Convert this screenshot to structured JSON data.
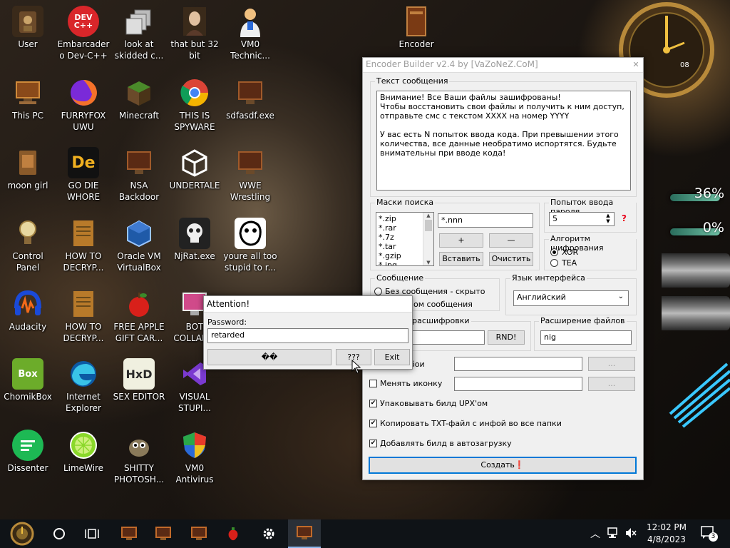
{
  "desktop": {
    "icons": [
      {
        "label": "User"
      },
      {
        "label": "Embarcadero Dev-C++"
      },
      {
        "label": "look at skidded c..."
      },
      {
        "label": "that but 32 bit"
      },
      {
        "label": "VM0 Technic..."
      },
      {
        "label": "Encoder"
      },
      {
        "label": "This PC"
      },
      {
        "label": "FURRYFOX UWU"
      },
      {
        "label": "Minecraft"
      },
      {
        "label": "THIS IS SPYWARE"
      },
      {
        "label": "sdfasdf.exe"
      },
      {
        "label": "moon girl"
      },
      {
        "label": "GO DIE WHORE"
      },
      {
        "label": "NSA Backdoor"
      },
      {
        "label": "UNDERTALE"
      },
      {
        "label": "WWE Wrestling"
      },
      {
        "label": "Control Panel"
      },
      {
        "label": "HOW TO DECRYP..."
      },
      {
        "label": "Oracle VM VirtualBox"
      },
      {
        "label": "NjRat.exe"
      },
      {
        "label": "youre all too stupid to r..."
      },
      {
        "label": "Audacity"
      },
      {
        "label": "HOW TO DECRYP..."
      },
      {
        "label": "FREE APPLE GIFT CAR..."
      },
      {
        "label": "BOT COLLAB..."
      },
      {
        "label": "ChomikBox"
      },
      {
        "label": "Internet Explorer"
      },
      {
        "label": "SEX EDITOR"
      },
      {
        "label": "VISUAL STUPI..."
      },
      {
        "label": "Dissenter"
      },
      {
        "label": "LimeWire"
      },
      {
        "label": "SHITTY PHOTOSH..."
      },
      {
        "label": "VM0 Antivirus"
      }
    ],
    "icon_glyphs": {
      "dev": "DEV C++",
      "de": "De",
      "box": "Box",
      "hxd": "HxD"
    }
  },
  "gauges": [
    {
      "label": "36%"
    },
    {
      "label": "0%"
    }
  ],
  "clock": {
    "label": "08"
  },
  "encoder": {
    "title": "Encoder Builder v2.4 by [VaZoNeZ.CoM]",
    "close": "✕",
    "message_group": "Текст сообщения",
    "message_text": "Внимание! Все Ваши файлы зашифрованы!\nЧтобы восстановить свои файлы и получить к ним доступ,\nотправьте смс с текстом XXXX на номер YYYY\n\nУ вас есть N попыток ввода кода. При превышении этого\nколичества, все данные необратимо испортятся. Будьте\nвнимательны при вводе кода!",
    "masks_group": "Маски поиска",
    "masks": [
      "*.zip",
      "*.rar",
      "*.7z",
      "*.tar",
      "*.gzip",
      "*.jpg"
    ],
    "mask_input": "*.nnn",
    "btn_plus": "+",
    "btn_minus": "—",
    "btn_paste": "Вставить",
    "btn_clear": "Очистить",
    "attempts_group": "Попыток ввода пароля",
    "attempts_value": "5",
    "attempts_help": "?",
    "algo_group": "Алгоритм шифрования",
    "algo_xor": "XOR",
    "algo_tea": "TEA",
    "message_opt_group": "Сообщение",
    "msg_opt_hidden": "Без сообщения - скрыто",
    "msg_opt_with": "ом сообщения",
    "lang_group": "Язык интерфейса",
    "lang_value": "Английский",
    "decrypt_group": "я расшифровки",
    "btn_rnd": "RND!",
    "ext_group": "Расширение файлов",
    "ext_value": "nig",
    "row_obi_label": "бои",
    "btn_browse": "...",
    "row_icon_label": "Менять иконку",
    "opt_upx": "Упаковывать билд UPX'ом",
    "opt_copy_txt": "Копировать TXT-файл с инфой во все папки",
    "opt_autorun": "Добавлять билд в автозагрузку",
    "btn_create": "Создать❗"
  },
  "dialog": {
    "title": "Attention!",
    "password_label": "Password:",
    "password_value": "retarded",
    "btn_unknown": "��",
    "btn_question": "???",
    "btn_exit": "Exit"
  },
  "taskbar": {
    "time": "12:02 PM",
    "date": "4/8/2023",
    "notification_count": "3"
  },
  "colors": {
    "taskbar": "#0f1317",
    "accent_border": "#0078d7"
  }
}
